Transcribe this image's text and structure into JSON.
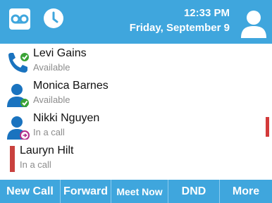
{
  "header": {
    "voicemail_icon": "voicemail-icon",
    "clock_icon": "clock-icon",
    "time": "12:33 PM",
    "date": "Friday, September 9",
    "user_icon": "user-icon",
    "colors": {
      "bar": "#3fa6dd",
      "text": "#ffffff"
    }
  },
  "contacts": [
    {
      "name": "Levi Gains",
      "status": "Available",
      "icon": "phone-icon",
      "presence": "available"
    },
    {
      "name": "Monica Barnes",
      "status": "Available",
      "icon": "person-icon",
      "presence": "available"
    },
    {
      "name": "Nikki Nguyen",
      "status": "In a call",
      "icon": "person-icon",
      "presence": "in-call"
    },
    {
      "name": "Lauryn Hilt",
      "status": "In a call",
      "icon": "red-bar",
      "presence": "in-call"
    }
  ],
  "softkeys": {
    "new_call": "New Call",
    "forward": "Forward",
    "meet_now": "Meet Now",
    "dnd": "DND",
    "more": "More"
  },
  "colors": {
    "accent": "#3fa6dd",
    "available": "#3aa335",
    "in_call": "#c9413e",
    "in_call_badge": "#b32f8a"
  }
}
